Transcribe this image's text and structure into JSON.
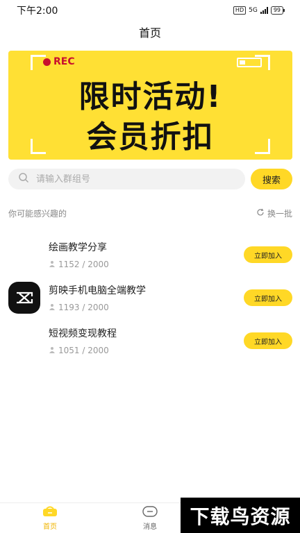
{
  "status_bar": {
    "time": "下午2:00",
    "hd": "HD",
    "network": "5G",
    "battery": "99"
  },
  "header": {
    "title": "首页"
  },
  "banner": {
    "rec_label": "REC",
    "line1": "限时活动!",
    "line2": "会员折扣"
  },
  "search": {
    "placeholder": "请输入群组号",
    "button_label": "搜索"
  },
  "section": {
    "title": "你可能感兴趣的",
    "refresh_label": "换一批"
  },
  "groups": [
    {
      "name": "绘画教学分享",
      "count": "1152 / 2000",
      "join_label": "立即加入"
    },
    {
      "name": "剪映手机电脑全端教学",
      "count": "1193 / 2000",
      "join_label": "立即加入"
    },
    {
      "name": "短视频变现教程",
      "count": "1051 / 2000",
      "join_label": "立即加入"
    }
  ],
  "tabbar": {
    "tabs": [
      {
        "label": "首页"
      },
      {
        "label": "消息"
      },
      {
        "label": ""
      }
    ]
  },
  "watermark": "下载鸟资源",
  "colors": {
    "accent": "#ffd826",
    "banner_bg": "#ffe034",
    "rec_red": "#c8102e",
    "active_tab": "#f0b400"
  }
}
